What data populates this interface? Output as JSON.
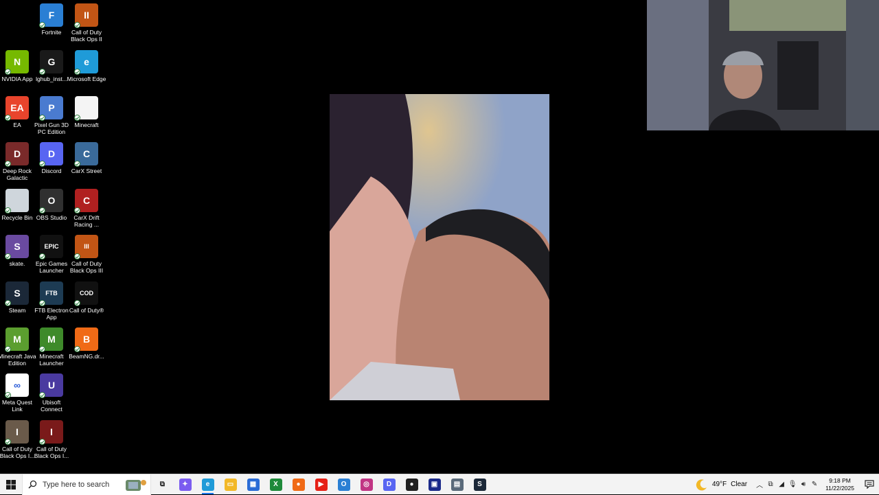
{
  "desktop": {
    "icons": [
      {
        "label": "Fortnite",
        "letter": "F",
        "color": "#2a7fd4"
      },
      {
        "label": "Call of Duty Black Ops II",
        "letter": "II",
        "color": "#c25515"
      },
      {
        "label": "NVIDIA App",
        "letter": "N",
        "color": "#76b900"
      },
      {
        "label": "lghub_inst...",
        "letter": "G",
        "color": "#1a1a1a"
      },
      {
        "label": "Microsoft Edge",
        "letter": "e",
        "color": "#1f9bd8"
      },
      {
        "label": "EA",
        "letter": "EA",
        "color": "#e8442c"
      },
      {
        "label": "Pixel Gun 3D PC Edition",
        "letter": "P",
        "color": "#4a7bd0"
      },
      {
        "label": "Minecraft",
        "letter": "",
        "color": "#f4f4f4"
      },
      {
        "label": "Deep Rock Galactic",
        "letter": "D",
        "color": "#7a2a2a"
      },
      {
        "label": "Discord",
        "letter": "D",
        "color": "#5865f2"
      },
      {
        "label": "CarX Street",
        "letter": "C",
        "color": "#3a6a9a"
      },
      {
        "label": "Recycle Bin",
        "letter": "",
        "color": "#cfd6dc"
      },
      {
        "label": "OBS Studio",
        "letter": "O",
        "color": "#303030"
      },
      {
        "label": "CarX Drift Racing ...",
        "letter": "C",
        "color": "#b02020"
      },
      {
        "label": "skate.",
        "letter": "S",
        "color": "#6a4aa0"
      },
      {
        "label": "Epic Games Launcher",
        "letter": "EPIC",
        "color": "#111111"
      },
      {
        "label": "Call of Duty Black Ops III",
        "letter": "III",
        "color": "#c25515"
      },
      {
        "label": "Steam",
        "letter": "S",
        "color": "#1b2838"
      },
      {
        "label": "FTB Electron App",
        "letter": "FTB",
        "color": "#1d3b53"
      },
      {
        "label": "Call of Duty®",
        "letter": "COD",
        "color": "#111111"
      },
      {
        "label": "Minecraft Java Edition",
        "letter": "M",
        "color": "#5b9e2f"
      },
      {
        "label": "Minecraft Launcher",
        "letter": "M",
        "color": "#3e8a2a"
      },
      {
        "label": "BeamNG.dr...",
        "letter": "B",
        "color": "#f06a16"
      },
      {
        "label": "Meta Quest Link",
        "letter": "∞",
        "color": "#ffffff"
      },
      {
        "label": "Ubisoft Connect",
        "letter": "U",
        "color": "#4a3aa0"
      },
      {
        "label": "Call of Duty Black Ops I...",
        "letter": "I",
        "color": "#6a5a4a"
      },
      {
        "label": "Call of Duty Black Ops I...",
        "letter": "I",
        "color": "#7a1a1a"
      }
    ]
  },
  "taskbar": {
    "search_placeholder": "Type here to search",
    "apps": [
      {
        "name": "task-view-icon",
        "glyph": "⧉",
        "color": "transparent",
        "fg": "#222"
      },
      {
        "name": "copilot-icon",
        "glyph": "✦",
        "color": "#7b5cf0",
        "fg": "#fff"
      },
      {
        "name": "edge-icon",
        "glyph": "e",
        "color": "#1f9bd8",
        "fg": "#fff",
        "active": true
      },
      {
        "name": "file-explorer-icon",
        "glyph": "▭",
        "color": "#f2b827",
        "fg": "#fff"
      },
      {
        "name": "microsoft-store-icon",
        "glyph": "▦",
        "color": "#2a6cd6",
        "fg": "#fff"
      },
      {
        "name": "xbox-icon",
        "glyph": "X",
        "color": "#1e8a3a",
        "fg": "#fff"
      },
      {
        "name": "chrome-like-icon",
        "glyph": "●",
        "color": "#f06a16",
        "fg": "#fff"
      },
      {
        "name": "youtube-icon",
        "glyph": "▶",
        "color": "#e62117",
        "fg": "#fff"
      },
      {
        "name": "outlook-icon",
        "glyph": "O",
        "color": "#2a7fd4",
        "fg": "#fff"
      },
      {
        "name": "instagram-icon",
        "glyph": "◎",
        "color": "#c13584",
        "fg": "#fff"
      },
      {
        "name": "discord-icon",
        "glyph": "D",
        "color": "#5865f2",
        "fg": "#fff"
      },
      {
        "name": "obs-icon",
        "glyph": "●",
        "color": "#202020",
        "fg": "#fff"
      },
      {
        "name": "app-blue-icon",
        "glyph": "▣",
        "color": "#1b2a8a",
        "fg": "#fff"
      },
      {
        "name": "game-app-icon",
        "glyph": "▤",
        "color": "#5a6a7a",
        "fg": "#fff"
      },
      {
        "name": "steam-icon",
        "glyph": "S",
        "color": "#1b2838",
        "fg": "#fff"
      }
    ],
    "weather": {
      "temp": "49°F",
      "condition": "Clear"
    },
    "clock": {
      "time": "9:18 PM",
      "date": "11/22/2025"
    }
  }
}
